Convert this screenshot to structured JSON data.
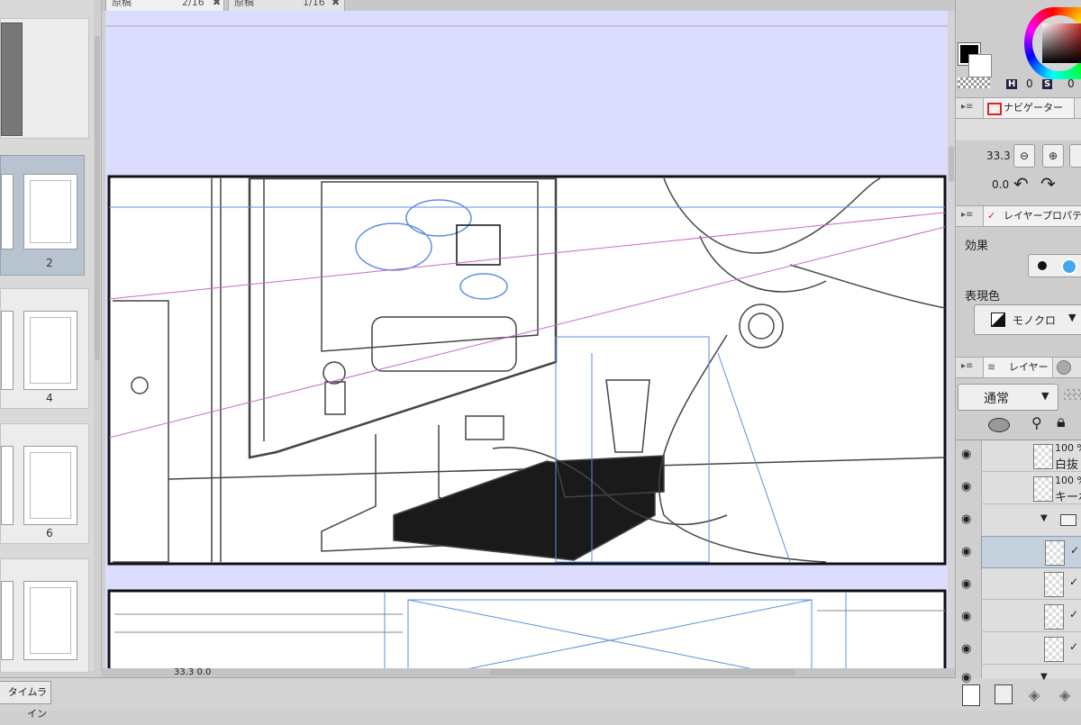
{
  "tabs": [
    {
      "label": "原稿",
      "pages": "2/16"
    },
    {
      "label": "原稿",
      "pages": "1/16"
    }
  ],
  "page_list": {
    "selected_page": "2",
    "page_labels": [
      "2",
      "4",
      "6"
    ]
  },
  "color": {
    "main_color": "#000000",
    "sub_color": "#ffffff",
    "h_label": "H",
    "h_value": "0",
    "s_label": "S",
    "s_value": "0",
    "accent_square": "#cc2b2b"
  },
  "navigator": {
    "title": "ナビゲーター",
    "zoom": "33.3",
    "rotation": "0.0"
  },
  "layer_properties": {
    "title": "レイヤープロパティ",
    "effect_label": "効果",
    "expression_color_label": "表現色",
    "expression_color_value": "モノクロ"
  },
  "layers": {
    "title": "レイヤー",
    "blend_mode": "通常",
    "items": [
      {
        "percent": "100 %",
        "name": "白抜"
      },
      {
        "percent": "100 %",
        "name": "キーボ"
      }
    ]
  },
  "status": {
    "zoom_readout": "33.3 0.0"
  },
  "timeline": {
    "label": "タイムライン"
  },
  "colors": {
    "canvas_bg": "#dcdcff",
    "panel_bg": "#cdcdcd",
    "selected_thumb": "#b7c4cf",
    "guide_blue": "#5b8fe0",
    "perspective_pink": "#cc66cc"
  }
}
